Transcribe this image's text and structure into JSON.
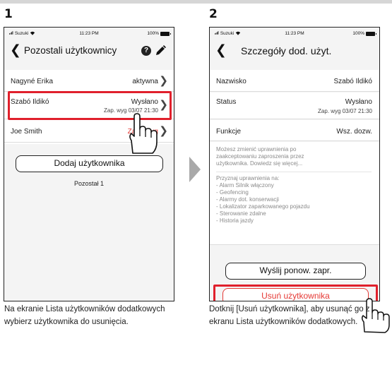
{
  "steps": [
    "1",
    "2"
  ],
  "status_bar": {
    "carrier": "Suzuki",
    "time": "11:23 PM",
    "battery": "100%"
  },
  "screen1": {
    "title": "Pozostali użytkownicy",
    "users": [
      {
        "name": "Nagyné Erika",
        "status": "aktywna",
        "sub": ""
      },
      {
        "name": "Szabó Ildikó",
        "status": "Wysłano",
        "sub": "Zap. wyg 03/07 21:30"
      },
      {
        "name": "Joe Smith",
        "status": "Zapr. wyg",
        "sub": ""
      }
    ],
    "add_button": "Dodaj użytkownika",
    "remaining": "Pozostał 1"
  },
  "screen2": {
    "title": "Szczegóły dod. użyt.",
    "surname_label": "Nazwisko",
    "surname_value": "Szabó Ildikó",
    "status_label": "Status",
    "status_value": "Wysłano",
    "status_sub": "Zap. wyg 03/07 21:30",
    "functions_label": "Funkcje",
    "functions_value": "Wsz. dozw.",
    "info_text": "Możesz zmienić uprawnienia po zaakceptowaniu zaproszenia przez użytkownika. Dowiedz się więcej...",
    "perms_title": "Przyznaj uprawnienia na:",
    "perms": [
      "- Alarm Silnik włączony",
      "- Geofencing",
      "- Alarmy dot. konserwacji",
      "- Lokalizator zaparkowanego pojazdu",
      "- Sterowanie zdalne",
      "- Historia jazdy"
    ],
    "resend_button": "Wyślij ponow. zapr.",
    "delete_button": "Usuń użytkownika"
  },
  "captions": {
    "step1": "Na ekranie Lista użytkowników dodatkowych wybierz użytkownika do usunięcia.",
    "step2": "Dotknij [Usuń użytkownika], aby usunąć go z ekranu Lista użytkowników dodatkowych."
  },
  "colors": {
    "highlight": "#e0202c",
    "red_text": "#e53935",
    "arrow": "#a9a9a9"
  }
}
